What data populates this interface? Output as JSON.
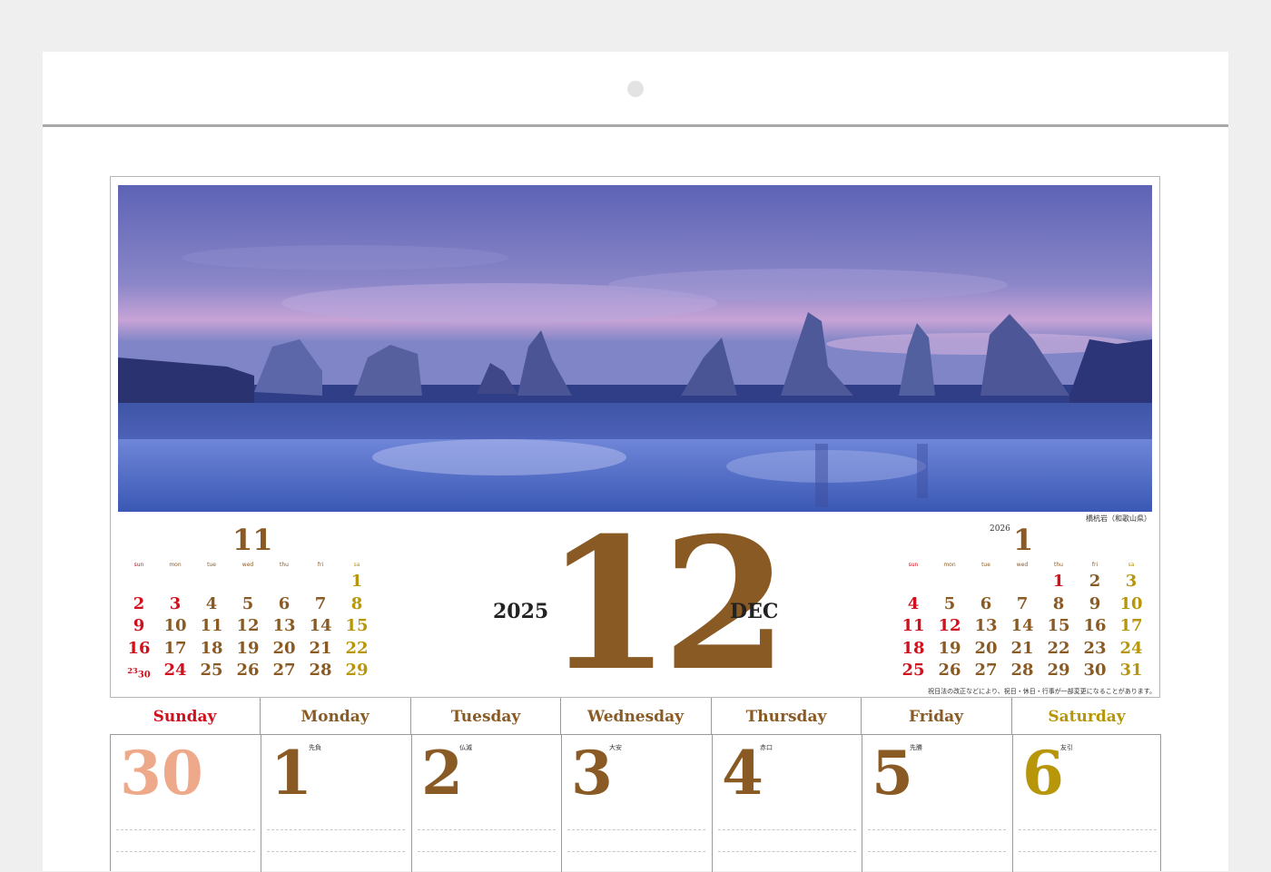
{
  "photo": {
    "caption": "橋杭岩（和歌山県）",
    "scene": "sea-stacks-at-dusk"
  },
  "prev_month": {
    "month": "11",
    "weekdays": [
      "sun",
      "mon",
      "tue",
      "wed",
      "thu",
      "fri",
      "sa"
    ],
    "rows": [
      [
        "",
        "",
        "",
        "",
        "",
        "",
        "1"
      ],
      [
        "2",
        "3",
        "4",
        "5",
        "6",
        "7",
        "8"
      ],
      [
        "9",
        "10",
        "11",
        "12",
        "13",
        "14",
        "15"
      ],
      [
        "16",
        "17",
        "18",
        "19",
        "20",
        "21",
        "22"
      ],
      [
        "23/30",
        "24",
        "25",
        "26",
        "27",
        "28",
        "29"
      ]
    ],
    "red": [
      "2",
      "3",
      "9",
      "16",
      "23/30",
      "24"
    ],
    "gold": [
      "1",
      "8",
      "15",
      "22",
      "29"
    ]
  },
  "next_month": {
    "year": "2026",
    "month": "1",
    "weekdays": [
      "sun",
      "mon",
      "tue",
      "wed",
      "thu",
      "fri",
      "sa"
    ],
    "rows": [
      [
        "",
        "",
        "",
        "",
        "1",
        "2",
        "3"
      ],
      [
        "4",
        "5",
        "6",
        "7",
        "8",
        "9",
        "10"
      ],
      [
        "11",
        "12",
        "13",
        "14",
        "15",
        "16",
        "17"
      ],
      [
        "18",
        "19",
        "20",
        "21",
        "22",
        "23",
        "24"
      ],
      [
        "25",
        "26",
        "27",
        "28",
        "29",
        "30",
        "31"
      ]
    ],
    "red": [
      "1",
      "4",
      "11",
      "12",
      "18",
      "25"
    ],
    "gold": [
      "3",
      "10",
      "17",
      "24",
      "31"
    ]
  },
  "current": {
    "year": "2025",
    "month": "12",
    "month_en": "DEC"
  },
  "note": "祝日法の改正などにより、祝日・休日・行事が一部変更になることがあります。",
  "weekday_headers": [
    "Sunday",
    "Monday",
    "Tuesday",
    "Wednesday",
    "Thursday",
    "Friday",
    "Saturday"
  ],
  "first_week": [
    {
      "day": "30",
      "rokuyo": ""
    },
    {
      "day": "1",
      "rokuyo": "先負"
    },
    {
      "day": "2",
      "rokuyo": "仏滅"
    },
    {
      "day": "3",
      "rokuyo": "大安"
    },
    {
      "day": "4",
      "rokuyo": "赤口"
    },
    {
      "day": "5",
      "rokuyo": "先勝"
    },
    {
      "day": "6",
      "rokuyo": "友引"
    }
  ],
  "colors": {
    "brown": "#8a5a24",
    "red": "#d0101c",
    "gold": "#b8960a",
    "sunday_prev": "#eda98a"
  }
}
